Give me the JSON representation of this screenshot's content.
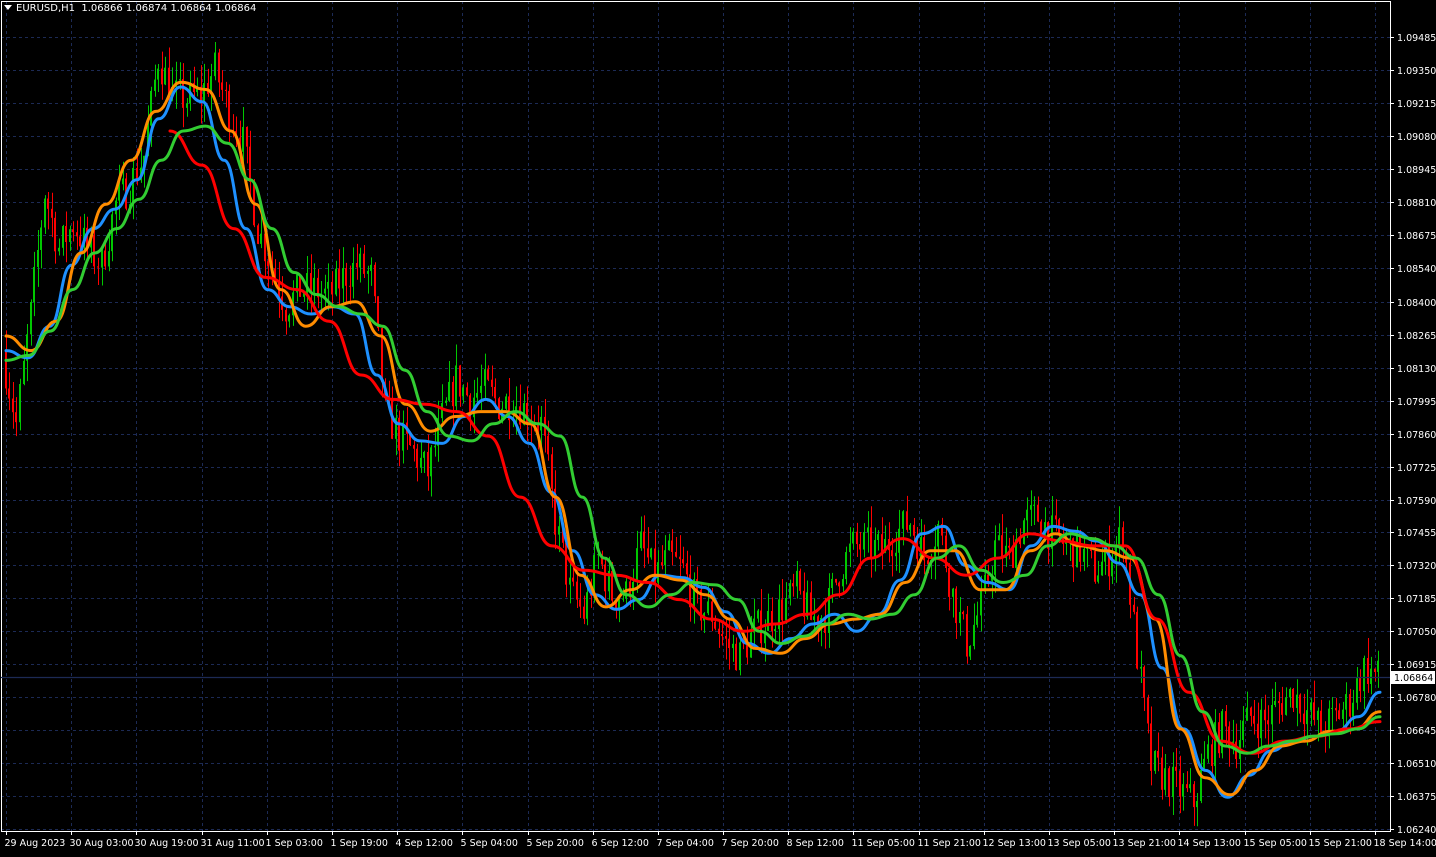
{
  "header": {
    "symbol": "EURUSD,H1",
    "ohlc": "1.06866 1.06874 1.06864 1.06864"
  },
  "colors": {
    "background": "#000000",
    "grid": "#1c2a55",
    "axis": "#ffffff",
    "bull": "#00c800",
    "bear": "#ff0000",
    "price_line": "#1c2a55",
    "ma_fast": "#1e90ff",
    "ma_orange": "#ff8c00",
    "ma_red": "#ff0000",
    "ma_green": "#32cd32"
  },
  "chart_data": {
    "type": "candlestick",
    "symbol": "EURUSD",
    "timeframe": "H1",
    "grid": true,
    "ylim": [
      1.0624,
      1.0962
    ],
    "yticks": [
      "1.09485",
      "1.09350",
      "1.09215",
      "1.09080",
      "1.08945",
      "1.08810",
      "1.08675",
      "1.08540",
      "1.08400",
      "1.08265",
      "1.08130",
      "1.07995",
      "1.07860",
      "1.07725",
      "1.07590",
      "1.07455",
      "1.07320",
      "1.07185",
      "1.07050",
      "1.06915",
      "1.06780",
      "1.06645",
      "1.06510",
      "1.06375",
      "1.06240"
    ],
    "xticks": [
      "29 Aug 2023",
      "30 Aug 03:00",
      "30 Aug 19:00",
      "31 Aug 11:00",
      "1 Sep 03:00",
      "1 Sep 19:00",
      "4 Sep 12:00",
      "5 Sep 04:00",
      "5 Sep 20:00",
      "6 Sep 12:00",
      "7 Sep 04:00",
      "7 Sep 20:00",
      "8 Sep 12:00",
      "11 Sep 05:00",
      "11 Sep 21:00",
      "12 Sep 13:00",
      "13 Sep 05:00",
      "13 Sep 21:00",
      "14 Sep 13:00",
      "15 Sep 05:00",
      "15 Sep 21:00",
      "18 Sep 14:00"
    ],
    "current_price": "1.06864",
    "price_path": [
      1.082,
      1.079,
      1.0835,
      1.0885,
      1.0862,
      1.0872,
      1.0862,
      1.0855,
      1.088,
      1.0888,
      1.09,
      1.094,
      1.0925,
      1.0923,
      1.0925,
      1.0935,
      1.0918,
      1.0905,
      1.087,
      1.0855,
      1.0838,
      1.0845,
      1.0845,
      1.0842,
      1.085,
      1.0855,
      1.085,
      1.0795,
      1.0785,
      1.0778,
      1.077,
      1.0792,
      1.0808,
      1.08,
      1.0805,
      1.0798,
      1.08,
      1.0795,
      1.079,
      1.075,
      1.0722,
      1.0712,
      1.0735,
      1.072,
      1.072,
      1.074,
      1.0728,
      1.0735,
      1.073,
      1.0715,
      1.0712,
      1.07,
      1.0695,
      1.0705,
      1.071,
      1.0715,
      1.0722,
      1.071,
      1.0712,
      1.073,
      1.074,
      1.074,
      1.0738,
      1.0745,
      1.075,
      1.0735,
      1.0748,
      1.072,
      1.07,
      1.0715,
      1.074,
      1.0735,
      1.075,
      1.0752,
      1.0745,
      1.074,
      1.0738,
      1.073,
      1.0735,
      1.0745,
      1.0695,
      1.065,
      1.0645,
      1.064,
      1.0635,
      1.0655,
      1.0665,
      1.066,
      1.067,
      1.0668,
      1.0675,
      1.068,
      1.0672,
      1.0665,
      1.067,
      1.0676,
      1.069,
      1.06864
    ],
    "series": [
      {
        "name": "MA fast",
        "color_key": "ma_fast",
        "values": [
          1.082,
          1.0817,
          1.083,
          1.0855,
          1.087,
          1.0878,
          1.089,
          1.0915,
          1.0928,
          1.0922,
          1.0898,
          1.087,
          1.0845,
          1.0838,
          1.0835,
          1.0838,
          1.0835,
          1.081,
          1.079,
          1.0783,
          1.0782,
          1.0793,
          1.08,
          1.0793,
          1.0782,
          1.0762,
          1.0738,
          1.072,
          1.0714,
          1.0718,
          1.0728,
          1.0727,
          1.0723,
          1.0713,
          1.07,
          1.0696,
          1.0702,
          1.0708,
          1.0712,
          1.0705,
          1.0712,
          1.0726,
          1.0745,
          1.0748,
          1.0732,
          1.0725,
          1.0722,
          1.074,
          1.0748,
          1.0746,
          1.0742,
          1.0733,
          1.072,
          1.069,
          1.0665,
          1.0648,
          1.0637,
          1.0646,
          1.0656,
          1.066,
          1.0662,
          1.0664,
          1.067,
          1.068
        ]
      },
      {
        "name": "MA orange",
        "color_key": "ma_orange",
        "values": [
          1.0826,
          1.082,
          1.0832,
          1.086,
          1.088,
          1.0898,
          1.0918,
          1.093,
          1.0927,
          1.091,
          1.088,
          1.0845,
          1.083,
          1.0838,
          1.084,
          1.0826,
          1.0798,
          1.0787,
          1.0793,
          1.0795,
          1.0795,
          1.079,
          1.076,
          1.0728,
          1.0715,
          1.0722,
          1.0728,
          1.0726,
          1.072,
          1.071,
          1.0698,
          1.0696,
          1.0702,
          1.0708,
          1.071,
          1.0712,
          1.0725,
          1.0738,
          1.0738,
          1.0722,
          1.0722,
          1.0738,
          1.0745,
          1.074,
          1.0738,
          1.0735,
          1.071,
          1.0665,
          1.0645,
          1.0638,
          1.0648,
          1.0658,
          1.066,
          1.0664,
          1.0665,
          1.0672
        ]
      },
      {
        "name": "MA red",
        "color_key": "ma_red",
        "values": [
          1.091,
          1.0896,
          1.087,
          1.085,
          1.0845,
          1.0832,
          1.081,
          1.08,
          1.0798,
          1.0795,
          1.0785,
          1.076,
          1.074,
          1.073,
          1.0728,
          1.0725,
          1.0718,
          1.071,
          1.0705,
          1.0708,
          1.0712,
          1.072,
          1.0735,
          1.0743,
          1.0735,
          1.0728,
          1.0735,
          1.0745,
          1.0742,
          1.074,
          1.074,
          1.071,
          1.068,
          1.066,
          1.0655,
          1.066,
          1.0662,
          1.0665,
          1.0668
        ]
      },
      {
        "name": "MA green",
        "color_key": "ma_green",
        "values": [
          1.0816,
          1.0818,
          1.0828,
          1.0845,
          1.086,
          1.087,
          1.0882,
          1.0898,
          1.091,
          1.0912,
          1.0905,
          1.089,
          1.087,
          1.0852,
          1.0843,
          1.0838,
          1.0835,
          1.083,
          1.0812,
          1.0795,
          1.0785,
          1.0783,
          1.079,
          1.0795,
          1.079,
          1.0785,
          1.076,
          1.0735,
          1.072,
          1.0715,
          1.072,
          1.0725,
          1.0724,
          1.0718,
          1.0705,
          1.07,
          1.0703,
          1.0708,
          1.0712,
          1.071,
          1.0712,
          1.072,
          1.0735,
          1.074,
          1.073,
          1.0725,
          1.0728,
          1.074,
          1.0745,
          1.0743,
          1.074,
          1.0735,
          1.072,
          1.0695,
          1.0672,
          1.0658,
          1.0655,
          1.0658,
          1.066,
          1.0662,
          1.0663,
          1.0665,
          1.067
        ]
      }
    ]
  }
}
